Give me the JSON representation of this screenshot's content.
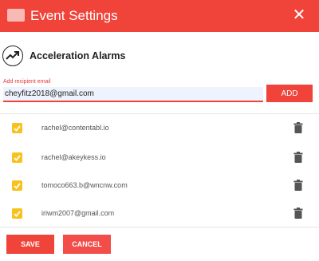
{
  "header": {
    "title": "Event Settings",
    "logo_icon": "blurred-logo",
    "close_icon": "close-icon"
  },
  "section": {
    "icon": "trending-up-icon",
    "label": "Acceleration Alarms"
  },
  "recipient": {
    "field_label": "Add recipient email",
    "value": "cheyfitz2018@gmail.com",
    "add_label": "ADD"
  },
  "recipients": [
    {
      "email": "rachel@contentabl.io",
      "checked": true
    },
    {
      "email": "rachel@akeykess.io",
      "checked": true
    },
    {
      "email": "tomoco663.b@wncnw.com",
      "checked": true
    },
    {
      "email": "iriwm2007@gmail.com",
      "checked": true
    }
  ],
  "footer": {
    "save_label": "SAVE",
    "cancel_label": "CANCEL"
  },
  "colors": {
    "accent": "#f0443a",
    "checkbox": "#f7c21e"
  }
}
